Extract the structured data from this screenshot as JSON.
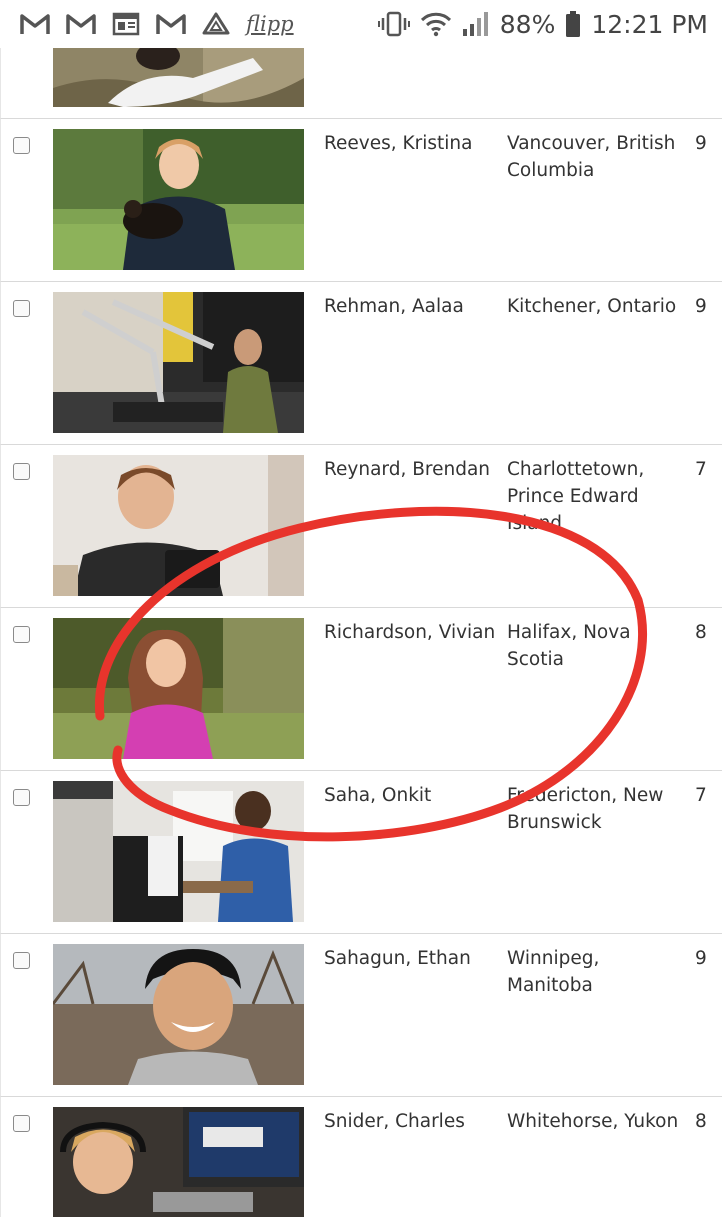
{
  "status_bar": {
    "left_icons": [
      "gmail-icon",
      "gmail-icon",
      "newspaper-icon",
      "gmail-icon",
      "drive-icon",
      "flipp-icon"
    ],
    "flipp_label": "flipp",
    "battery": "88%",
    "time": "12:21 PM"
  },
  "table": {
    "rows": [
      {
        "name": "Reeves, Kristina",
        "city": "Vancouver, British Columbia",
        "grade": "9"
      },
      {
        "name": "Rehman, Aalaa",
        "city": "Kitchener, Ontario",
        "grade": "9"
      },
      {
        "name": "Reynard, Brendan",
        "city": "Charlottetown, Prince Edward Island",
        "grade": "7"
      },
      {
        "name": "Richardson, Vivian",
        "city": "Halifax, Nova Scotia",
        "grade": "8"
      },
      {
        "name": "Saha, Onkit",
        "city": "Fredericton, New Brunswick",
        "grade": "7"
      },
      {
        "name": "Sahagun, Ethan",
        "city": "Winnipeg, Manitoba",
        "grade": "9"
      },
      {
        "name": "Snider, Charles",
        "city": "Whitehorse, Yukon",
        "grade": "8"
      }
    ]
  },
  "annotation": {
    "color": "#e8342c"
  }
}
